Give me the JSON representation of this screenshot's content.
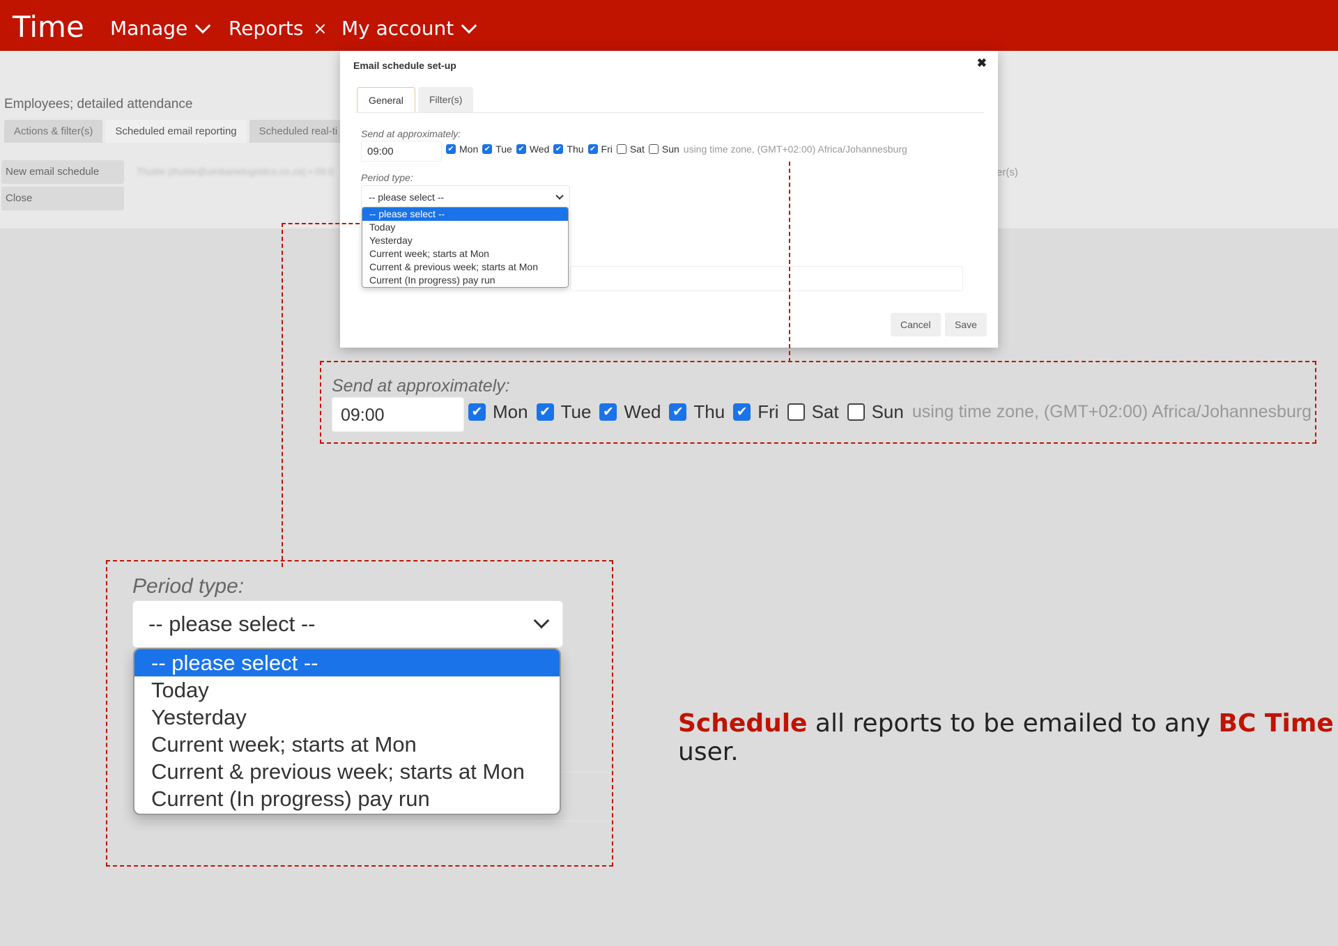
{
  "nav": {
    "brand": "Time",
    "items": [
      {
        "label": "Manage"
      },
      {
        "label": "Reports"
      },
      {
        "label": "My account"
      }
    ]
  },
  "background": {
    "title": "Employees; detailed attendance",
    "tabs": [
      "Actions & filter(s)",
      "Scheduled email reporting",
      "Scheduled real-ti"
    ],
    "side_buttons": [
      "New email schedule",
      "Close"
    ],
    "row_preview": "Thulile (thulile@umbanelogistics.co.za) • 09:0",
    "right_fragment": "er(s)"
  },
  "modal": {
    "title": "Email schedule set-up",
    "close": "✖",
    "tabs": [
      "General",
      "Filter(s)"
    ],
    "send_label": "Send at approximately:",
    "time_value": "09:00",
    "days": [
      {
        "label": "Mon",
        "checked": true
      },
      {
        "label": "Tue",
        "checked": true
      },
      {
        "label": "Wed",
        "checked": true
      },
      {
        "label": "Thu",
        "checked": true
      },
      {
        "label": "Fri",
        "checked": true
      },
      {
        "label": "Sat",
        "checked": false
      },
      {
        "label": "Sun",
        "checked": false
      }
    ],
    "timezone": "using time zone, (GMT+02:00) Africa/Johannesburg",
    "period_label": "Period type:",
    "period_selected": "-- please select --",
    "period_options": [
      "-- please select --",
      "Today",
      "Yesterday",
      "Current week; starts at Mon",
      "Current & previous week; starts at Mon",
      "Current (In progress) pay run"
    ],
    "cancel": "Cancel",
    "save": "Save"
  },
  "tagline": {
    "part1": "Schedule",
    "part2": " all reports to be emailed to any ",
    "part3": "BC Time",
    "part4": " user."
  },
  "colors": {
    "brand_red": "#c01300",
    "select_blue": "#1a73e8",
    "page_bg": "#dcdcdc"
  }
}
